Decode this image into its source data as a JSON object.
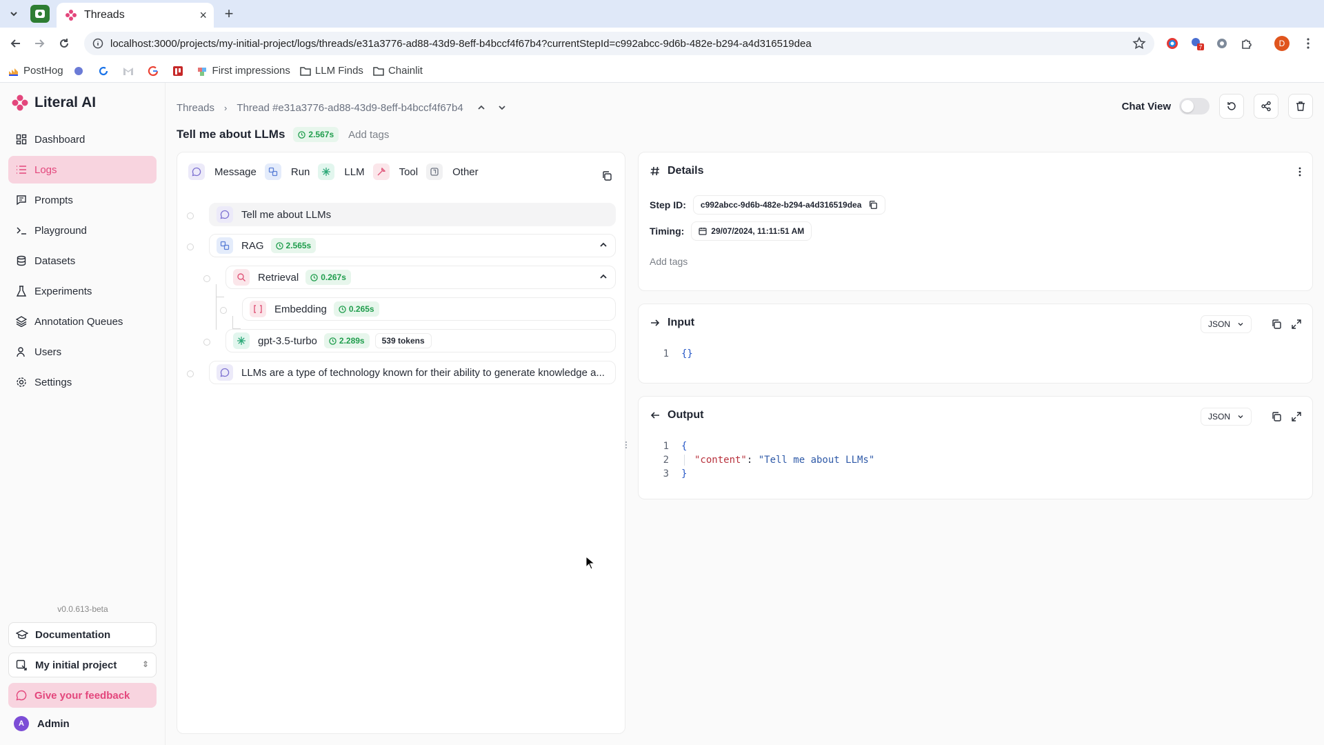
{
  "browser": {
    "tab_title": "Threads",
    "url": "localhost:3000/projects/my-initial-project/logs/threads/e31a3776-ad88-43d9-8eff-b4bccf4f67b4?currentStepId=c992abcc-9d6b-482e-b294-a4d316519dea",
    "bookmarks": [
      {
        "label": "PostHog",
        "icon": "posthog-icon"
      },
      {
        "label": "",
        "icon": "bookmark-app-icon"
      },
      {
        "label": "",
        "icon": "bookmark-refresh-icon"
      },
      {
        "label": "",
        "icon": "gmail-icon"
      },
      {
        "label": "",
        "icon": "google-icon"
      },
      {
        "label": "",
        "icon": "bookmark-red-icon"
      },
      {
        "label": "First impressions",
        "icon": "bookmark-app-icon"
      },
      {
        "label": "LLM Finds",
        "icon": "folder-icon"
      },
      {
        "label": "Chainlit",
        "icon": "folder-icon"
      }
    ],
    "extension_badge": "7",
    "profile_initial": "D"
  },
  "app": {
    "name": "Literal AI",
    "brand_color": "#e3467c",
    "nav": [
      {
        "label": "Dashboard",
        "icon": "dashboard-icon",
        "active": false
      },
      {
        "label": "Logs",
        "icon": "logs-icon",
        "active": true
      },
      {
        "label": "Prompts",
        "icon": "prompts-icon",
        "active": false
      },
      {
        "label": "Playground",
        "icon": "terminal-icon",
        "active": false
      },
      {
        "label": "Datasets",
        "icon": "database-icon",
        "active": false
      },
      {
        "label": "Experiments",
        "icon": "flask-icon",
        "active": false
      },
      {
        "label": "Annotation Queues",
        "icon": "layers-icon",
        "active": false
      },
      {
        "label": "Users",
        "icon": "users-icon",
        "active": false
      },
      {
        "label": "Settings",
        "icon": "gear-icon",
        "active": false
      }
    ],
    "version": "v0.0.613-beta",
    "documentation_label": "Documentation",
    "project_label": "My initial project",
    "feedback_label": "Give your feedback",
    "user": {
      "name": "Admin",
      "initial": "A"
    }
  },
  "header": {
    "breadcrumb_root": "Threads",
    "breadcrumb_current": "Thread #e31a3776-ad88-43d9-8eff-b4bccf4f67b4",
    "chat_view_label": "Chat View",
    "chat_view_on": false
  },
  "thread": {
    "title": "Tell me about LLMs",
    "duration": "2.567s",
    "add_tags": "Add tags"
  },
  "filters": [
    {
      "label": "Message",
      "icon": "message-icon"
    },
    {
      "label": "Run",
      "icon": "run-icon"
    },
    {
      "label": "LLM",
      "icon": "llm-icon"
    },
    {
      "label": "Tool",
      "icon": "tool-icon"
    },
    {
      "label": "Other",
      "icon": "other-icon"
    }
  ],
  "steps": [
    {
      "name": "Tell me about LLMs",
      "type": "message",
      "icon": "message-icon",
      "depth": 0
    },
    {
      "name": "RAG",
      "type": "run",
      "icon": "run-icon",
      "depth": 0,
      "duration": "2.565s",
      "expanded": true
    },
    {
      "name": "Retrieval",
      "type": "retrieval",
      "icon": "search-icon",
      "depth": 1,
      "duration": "0.267s",
      "expanded": true
    },
    {
      "name": "Embedding",
      "type": "embedding",
      "icon": "brackets-icon",
      "depth": 2,
      "duration": "0.265s"
    },
    {
      "name": "gpt-3.5-turbo",
      "type": "llm",
      "icon": "llm-icon",
      "depth": 1,
      "duration": "2.289s",
      "tokens": "539 tokens"
    },
    {
      "name": "LLMs are a type of technology known for their ability to generate knowledge a...",
      "type": "message",
      "icon": "message-icon",
      "depth": 0
    }
  ],
  "details": {
    "title": "Details",
    "step_id_label": "Step ID:",
    "step_id": "c992abcc-9d6b-482e-b294-a4d316519dea",
    "timing_label": "Timing:",
    "timing": "29/07/2024, 11:11:51 AM",
    "add_tags": "Add tags"
  },
  "input": {
    "title": "Input",
    "format": "JSON",
    "lines": [
      {
        "n": "1",
        "text": "{}"
      }
    ]
  },
  "output": {
    "title": "Output",
    "format": "JSON",
    "line_numbers": [
      "1",
      "2",
      "3"
    ],
    "open_brace": "{",
    "key": "\"content\"",
    "colon": ": ",
    "value": "\"Tell me about LLMs\"",
    "close_brace": "}"
  }
}
